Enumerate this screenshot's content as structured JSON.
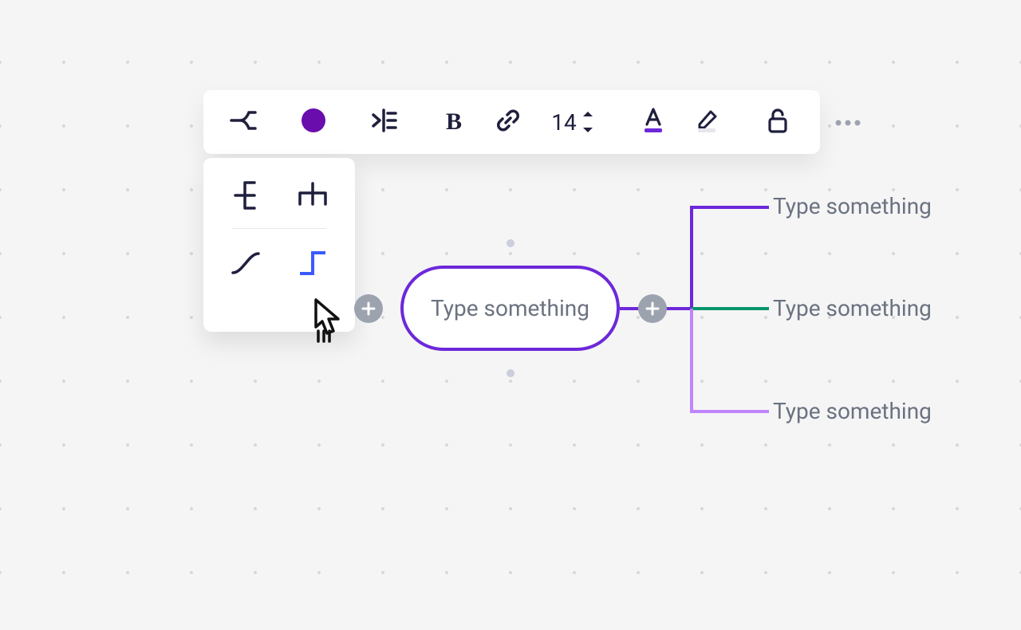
{
  "toolbar": {
    "font_size": "14"
  },
  "dropdown": {
    "options": [
      "tree-right",
      "tree-down",
      "curve",
      "elbow"
    ],
    "selected": "elbow"
  },
  "node": {
    "placeholder": "Type something"
  },
  "children": [
    {
      "placeholder": "Type something",
      "color": "#6d28d9"
    },
    {
      "placeholder": "Type something",
      "color": "#059669"
    },
    {
      "placeholder": "Type something",
      "color": "#c084fc"
    }
  ],
  "colors": {
    "accent": "#6d28d9",
    "shape_fill": "#6a0dad"
  },
  "icons": {
    "branch": "branch-icon",
    "shape": "shape-icon",
    "align": "align-icon",
    "bold": "bold-icon",
    "link": "link-icon",
    "text_color": "text-color-icon",
    "highlight": "highlight-icon",
    "lock": "unlock-icon",
    "more": "more-icon",
    "plus": "plus-icon"
  }
}
